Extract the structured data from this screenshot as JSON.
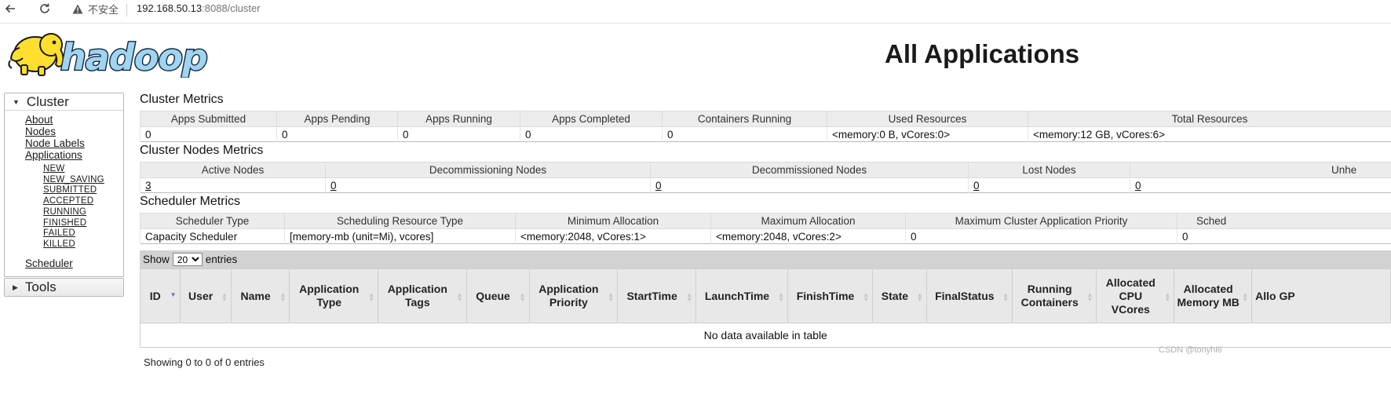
{
  "browser": {
    "security_label": "不安全",
    "url_host": "192.168.50.13",
    "url_rest": ":8088/cluster"
  },
  "header": {
    "logo_text": "hadoop",
    "title": "All Applications"
  },
  "sidebar": {
    "cluster_label": "Cluster",
    "links": [
      "About",
      "Nodes",
      "Node Labels",
      "Applications"
    ],
    "states": [
      "NEW",
      "NEW_SAVING",
      "SUBMITTED",
      "ACCEPTED",
      "RUNNING",
      "FINISHED",
      "FAILED",
      "KILLED"
    ],
    "scheduler_label": "Scheduler",
    "tools_label": "Tools"
  },
  "cluster_metrics": {
    "title": "Cluster Metrics",
    "headers": [
      "Apps Submitted",
      "Apps Pending",
      "Apps Running",
      "Apps Completed",
      "Containers Running",
      "Used Resources",
      "Total Resources"
    ],
    "values": [
      "0",
      "0",
      "0",
      "0",
      "0",
      "<memory:0 B, vCores:0>",
      "<memory:12 GB, vCores:6>"
    ]
  },
  "nodes_metrics": {
    "title": "Cluster Nodes Metrics",
    "headers": [
      "Active Nodes",
      "Decommissioning Nodes",
      "Decommissioned Nodes",
      "Lost Nodes",
      "Unhe"
    ],
    "values": [
      "3",
      "0",
      "0",
      "0",
      "0"
    ]
  },
  "scheduler_metrics": {
    "title": "Scheduler Metrics",
    "headers": [
      "Scheduler Type",
      "Scheduling Resource Type",
      "Minimum Allocation",
      "Maximum Allocation",
      "Maximum Cluster Application Priority",
      "Sched"
    ],
    "values": [
      "Capacity Scheduler",
      "[memory-mb (unit=Mi), vcores]",
      "<memory:2048, vCores:1>",
      "<memory:2048, vCores:2>",
      "0",
      "0"
    ]
  },
  "apps": {
    "show_label": "Show",
    "entries_label": "entries",
    "page_size": "20",
    "page_size_options": [
      "20"
    ],
    "columns": [
      "ID",
      "User",
      "Name",
      "Application Type",
      "Application Tags",
      "Queue",
      "Application Priority",
      "StartTime",
      "LaunchTime",
      "FinishTime",
      "State",
      "FinalStatus",
      "Running Containers",
      "Allocated CPU VCores",
      "Allocated Memory MB",
      "Allo GP"
    ],
    "empty_message": "No data available in table",
    "showing_text": "Showing 0 to 0 of 0 entries"
  },
  "watermark": "CSDN @tonyhi6"
}
